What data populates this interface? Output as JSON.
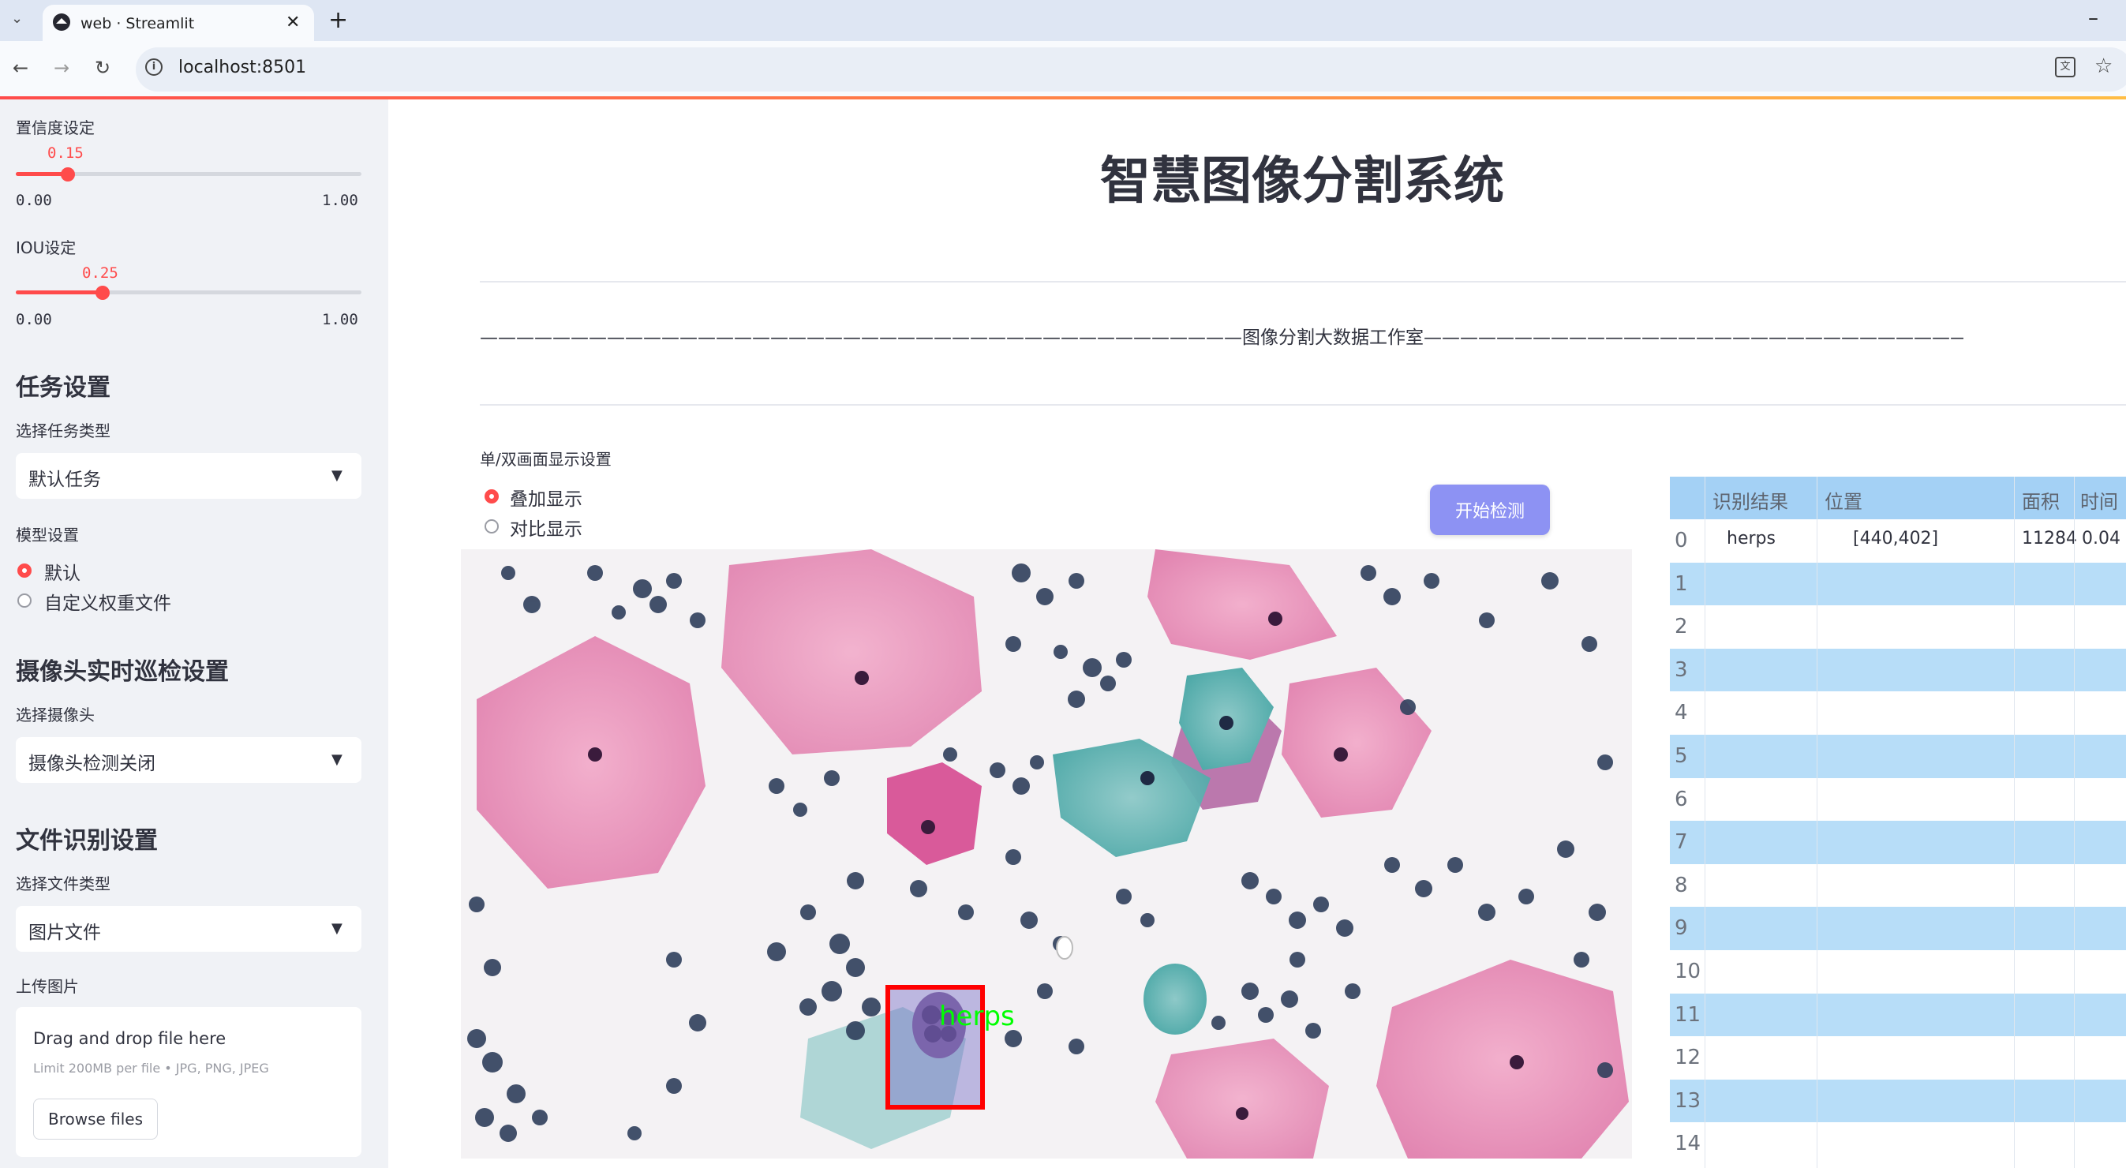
{
  "browser": {
    "tab_title": "web · Streamlit",
    "url": "localhost:8501",
    "new_tab": "+",
    "minimize": "–"
  },
  "sidebar": {
    "confidence": {
      "label": "置信度设定",
      "value": "0.15",
      "min": "0.00",
      "max": "1.00",
      "level": 0.15
    },
    "iou": {
      "label": "IOU设定",
      "value": "0.25",
      "min": "0.00",
      "max": "1.00",
      "level": 0.25
    },
    "task_section": "任务设置",
    "task_type_label": "选择任务类型",
    "task_type_value": "默认任务",
    "model_label": "模型设置",
    "model_options": [
      "默认",
      "自定义权重文件"
    ],
    "camera_section": "摄像头实时巡检设置",
    "camera_label": "选择摄像头",
    "camera_value": "摄像头检测关闭",
    "file_section": "文件识别设置",
    "file_type_label": "选择文件类型",
    "file_type_value": "图片文件",
    "upload_label": "上传图片",
    "upload_drop": "Drag and drop file here",
    "upload_limit": "Limit 200MB per file • JPG, PNG, JPEG",
    "upload_button": "Browse files"
  },
  "main": {
    "title": "智慧图像分割系统",
    "banner": "——————————————————————————————————————————图像分割大数据工作室——————————————————————————————————————————",
    "display_label": "单/双画面显示设置",
    "display_options": [
      "叠加显示",
      "对比显示"
    ],
    "start_button": "开始检测",
    "detection_label": "herps"
  },
  "table": {
    "headers": [
      "识别结果",
      "位置",
      "面积",
      "时间"
    ],
    "rows": [
      {
        "index": "0",
        "result": "herps",
        "position": "[440,402]",
        "area": "11284",
        "time": "0.04"
      },
      {
        "index": "1"
      },
      {
        "index": "2"
      },
      {
        "index": "3"
      },
      {
        "index": "4"
      },
      {
        "index": "5"
      },
      {
        "index": "6"
      },
      {
        "index": "7"
      },
      {
        "index": "8"
      },
      {
        "index": "9"
      },
      {
        "index": "10"
      },
      {
        "index": "11"
      },
      {
        "index": "12"
      },
      {
        "index": "13"
      },
      {
        "index": "14"
      }
    ]
  },
  "colors": {
    "accent": "#ff4b4b",
    "sidebar_bg": "#f0f2f6",
    "button": "#8d92f3",
    "table_header": "#a4d1f5",
    "table_stripe": "#b7ddf8",
    "detection_box": "#ff0000",
    "detection_text": "#00ff00"
  }
}
